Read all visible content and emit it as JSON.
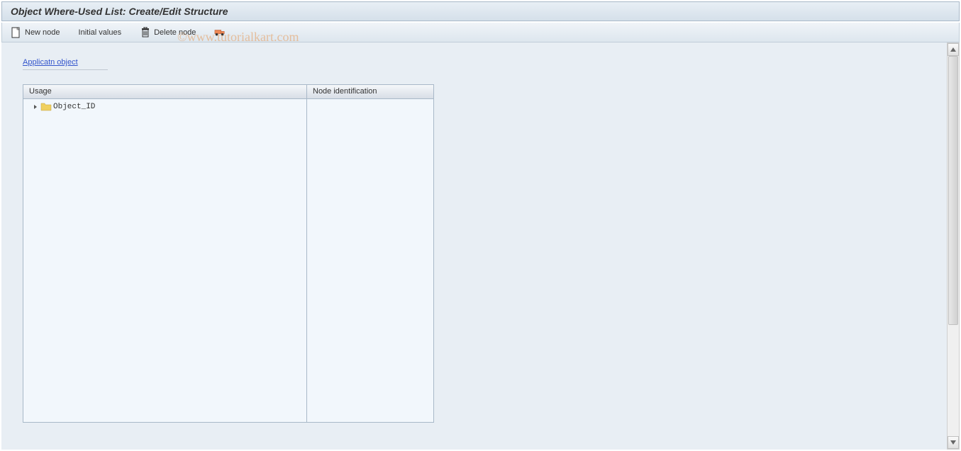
{
  "header": {
    "title": "Object Where-Used List: Create/Edit Structure"
  },
  "toolbar": {
    "new_node_label": "New node",
    "initial_values_label": "Initial values",
    "delete_node_label": "Delete node"
  },
  "content": {
    "field_label": "Applicatn object"
  },
  "tree_table": {
    "columns": {
      "usage_header": "Usage",
      "node_id_header": "Node identification"
    },
    "rows": [
      {
        "label": "Object_ID",
        "node_id": ""
      }
    ]
  },
  "watermark": "©www.tutorialkart.com"
}
